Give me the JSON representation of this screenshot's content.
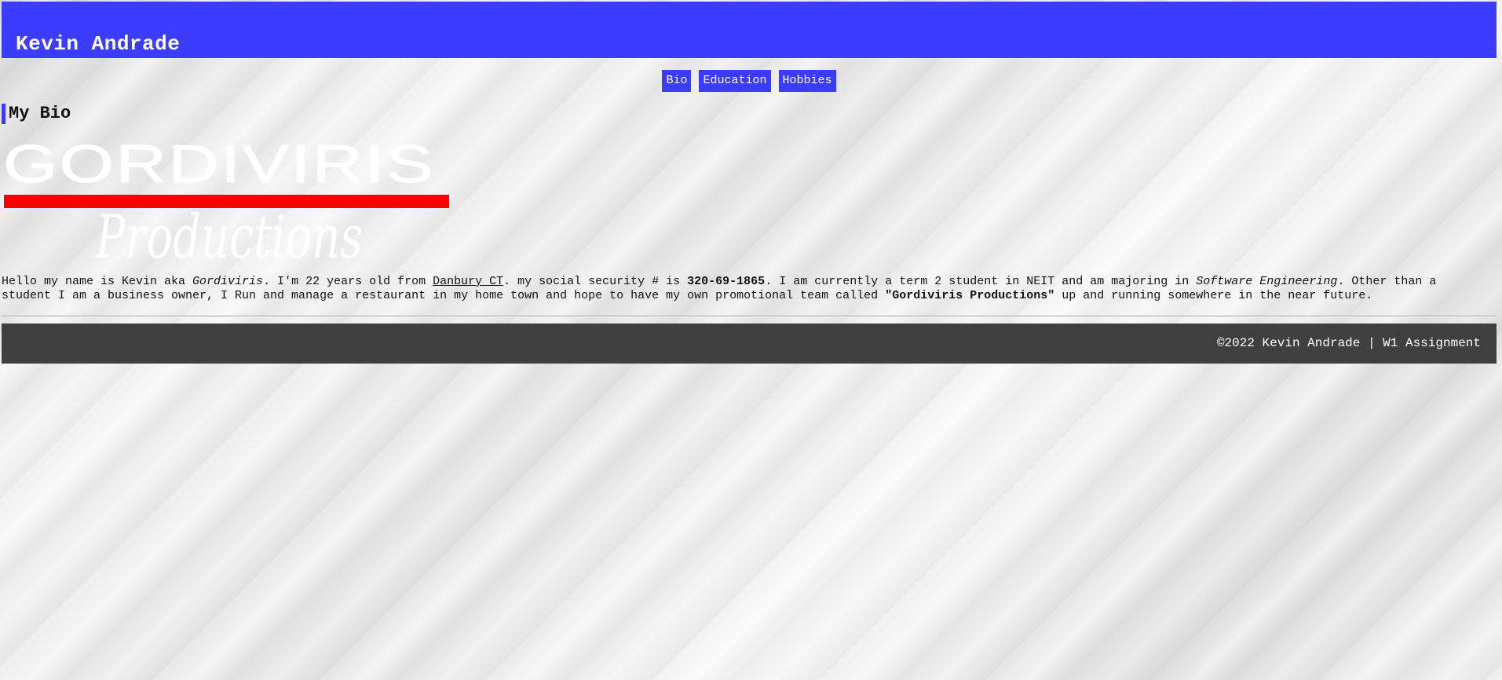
{
  "header": {
    "title": "Kevin Andrade"
  },
  "nav": {
    "items": [
      {
        "label": "Bio"
      },
      {
        "label": "Education"
      },
      {
        "label": "Hobbies"
      }
    ]
  },
  "main": {
    "section_title": "My Bio",
    "logo": {
      "line1": "GORDIVIRIS",
      "line2": "Productions",
      "bar_color": "#ff0000",
      "text_color": "#ffffff"
    },
    "bio": {
      "p1": "Hello my name is Kevin aka ",
      "alias": "Gordiviris",
      "p2": ". I'm 22 years old from ",
      "hometown": "Danbury CT",
      "p3": ". my social security # is ",
      "ssn": "320-69-1865",
      "p4": ". I am currently a term 2 student in NEIT and am majoring in ",
      "major": "Software Engineering",
      "p5": ". Other than a student I am a business owner, I Run and manage a restaurant in my home town and hope to have my own promotional team called ",
      "team": "\"Gordiviris Productions\"",
      "p6": " up and running somewhere in the near future."
    }
  },
  "footer": {
    "text": "©2022 Kevin Andrade | W1 Assignment"
  },
  "colors": {
    "accent": "#3a3cff",
    "footer_bg": "#3f3f3f"
  }
}
